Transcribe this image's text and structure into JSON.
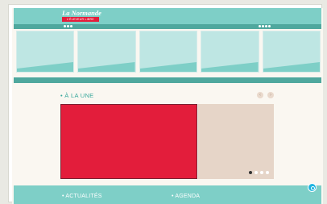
{
  "header": {
    "logo_text": "La Normande",
    "logo_tag": "L'ÉLEVEUR LIBRE"
  },
  "une": {
    "title": "• À LA UNE"
  },
  "carousel": {
    "slides": 4,
    "active_index": 0
  },
  "footer": {
    "link_news": "• ACTUALITÉS",
    "link_agenda": "• AGENDA"
  },
  "colors": {
    "teal": "#7ecfc7",
    "teal_dark": "#4fa89e",
    "red": "#e31d3b",
    "beige": "#e6d5c8",
    "chat": "#1fb4e0"
  },
  "icons": {
    "prev": "chevron-left-icon",
    "next": "chevron-right-icon",
    "chat": "chat-icon"
  }
}
